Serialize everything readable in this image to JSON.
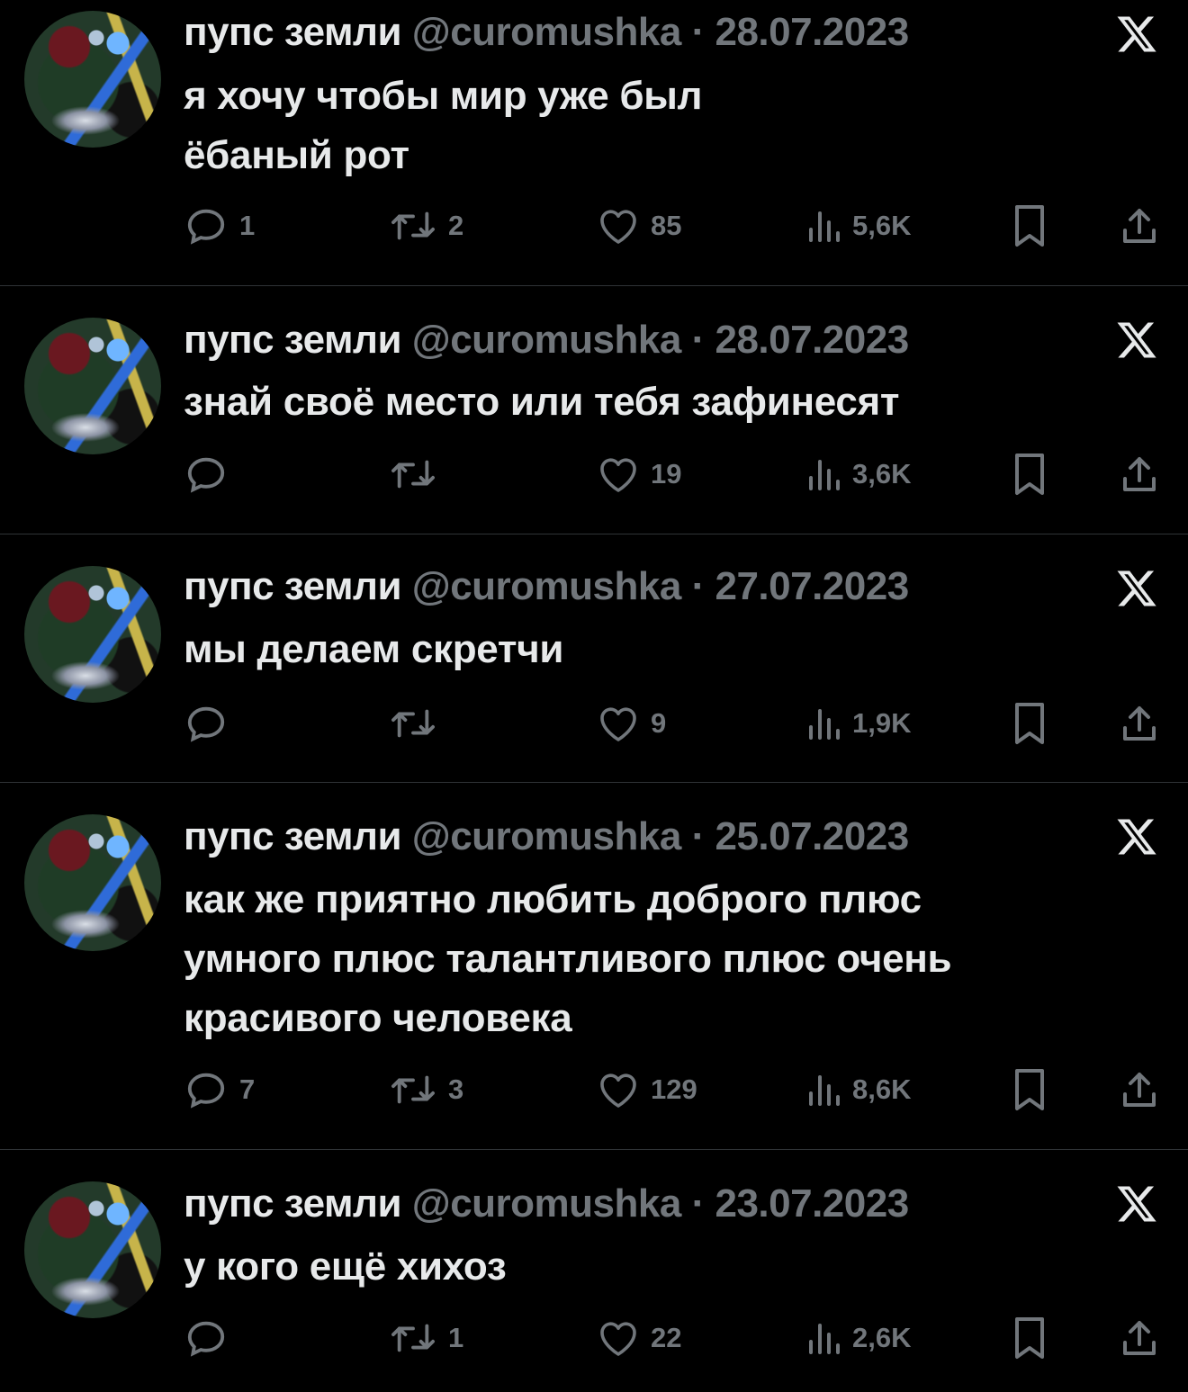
{
  "tweets": [
    {
      "name": "пупс земли",
      "handle": "@curomushka",
      "date": "28.07.2023",
      "text_lines": [
        "я хочу чтобы мир уже был",
        "ёбаный рот"
      ],
      "replies": "1",
      "retweets": "2",
      "likes": "85",
      "views": "5,6K"
    },
    {
      "name": "пупс земли",
      "handle": "@curomushka",
      "date": "28.07.2023",
      "text_lines": [
        "знай своё место или тебя зафинесят"
      ],
      "replies": "",
      "retweets": "",
      "likes": "19",
      "views": "3,6K"
    },
    {
      "name": "пупс земли",
      "handle": "@curomushka",
      "date": "27.07.2023",
      "text_lines": [
        "мы делаем скретчи"
      ],
      "replies": "",
      "retweets": "",
      "likes": "9",
      "views": "1,9K"
    },
    {
      "name": "пупс земли",
      "handle": "@curomushka",
      "date": "25.07.2023",
      "text_lines": [
        "как же приятно любить доброго плюс",
        "умного плюс талантливого плюс очень",
        "красивого человека"
      ],
      "replies": "7",
      "retweets": "3",
      "likes": "129",
      "views": "8,6K"
    },
    {
      "name": "пупс земли",
      "handle": "@curomushka",
      "date": "23.07.2023",
      "text_lines": [
        "у кого ещё хихоз"
      ],
      "replies": "",
      "retweets": "1",
      "likes": "22",
      "views": "2,6K"
    }
  ],
  "separator": "·",
  "icons": {
    "reply": "reply-icon",
    "retweet": "retweet-icon",
    "like": "heart-icon",
    "views": "views-icon",
    "bookmark": "bookmark-icon",
    "share": "share-icon",
    "platform": "x-logo-icon"
  },
  "colors": {
    "background": "#000000",
    "text": "#e7e9ea",
    "secondary": "#71767b",
    "divider": "#2f3336"
  }
}
